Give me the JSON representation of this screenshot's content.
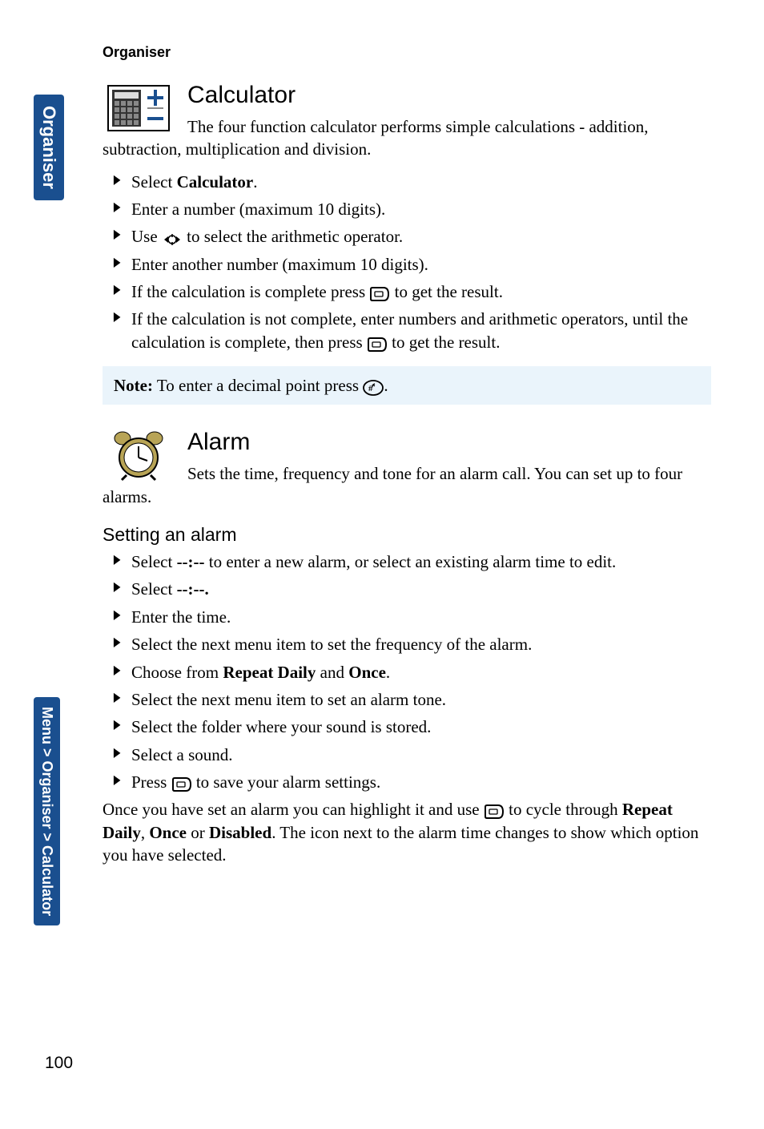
{
  "header": {
    "section": "Organiser"
  },
  "sidetabs": {
    "top": "Organiser",
    "bottom": "Menu > Organiser > Calculator"
  },
  "calculator": {
    "title": "Calculator",
    "intro": "The four function calculator performs simple calculations - addition, subtraction, multiplication and division.",
    "steps": {
      "s1a": "Select ",
      "s1b": "Calculator",
      "s1c": ".",
      "s2": "Enter a number (maximum 10 digits).",
      "s3a": "Use ",
      "s3b": " to select the arithmetic operator.",
      "s4": "Enter another number (maximum 10 digits).",
      "s5a": "If the calculation is complete press ",
      "s5b": " to get the result.",
      "s6a": "If the calculation is not complete, enter numbers and arithmetic operators, until the calculation is complete, then press ",
      "s6b": " to get the result."
    },
    "note": {
      "label": "Note:",
      "text": " To enter a decimal point press ",
      "tail": "."
    }
  },
  "alarm": {
    "title": "Alarm",
    "intro": "Sets the time, frequency and tone for an alarm call. You can set up to four alarms.",
    "subheading": "Setting an alarm",
    "steps": {
      "s1a": "Select ",
      "s1b": "--:--",
      "s1c": " to enter a new alarm, or select an existing alarm time to edit.",
      "s2a": "Select ",
      "s2b": "--:--.",
      "s3": "Enter the time.",
      "s4": "Select the next menu item to set the frequency of the alarm.",
      "s5a": "Choose from ",
      "s5b": "Repeat Daily",
      "s5c": " and ",
      "s5d": "Once",
      "s5e": ".",
      "s6": "Select the next menu item to set an alarm tone.",
      "s7": "Select the folder where your sound is stored.",
      "s8": "Select a sound.",
      "s9a": "Press ",
      "s9b": " to save your alarm settings."
    },
    "para": {
      "p1": "Once you have set an alarm you can highlight it and use ",
      "p2": " to cycle through ",
      "p3": "Repeat Daily",
      "p4": ", ",
      "p5": "Once",
      "p6": " or ",
      "p7": "Disabled",
      "p8": ". The icon next to the alarm time changes to show which option you have selected."
    }
  },
  "pageNumber": "100"
}
